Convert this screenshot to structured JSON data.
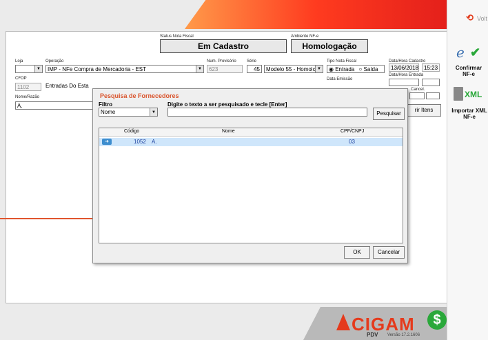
{
  "header": {
    "voltar_label": "Volt"
  },
  "status": {
    "status_label": "Status Nota Fiscal",
    "status_value": "Em Cadastro",
    "ambiente_label": "Ambiente NF-e",
    "ambiente_value": "Homologação"
  },
  "form": {
    "loja_label": "Loja",
    "loja_value": "",
    "operacao_label": "Operação",
    "operacao_value": "IMP - NFe Compra de Mercadoria - EST",
    "num_label": "Num. Provisório",
    "num_value": "623",
    "serie_label": "Série",
    "serie_value": "45",
    "modelo_value": "Modelo 55 - Homolc",
    "tipo_label": "Tipo Nota Fiscal",
    "entrada_label": "Entrada",
    "saida_label": "Saída",
    "dh_cadastro_label": "Data/Hora Cadastro",
    "dh_cadastro_date": "13/06/2018",
    "dh_cadastro_time": "15:23",
    "dh_entrada_label": "Data/Hora Entrada",
    "cfop_label": "CFOP",
    "cfop_code": "1102",
    "cfop_desc": "Entradas Do Esta",
    "data_emissao_label": "Data Emissão",
    "cancel_label": "Cancel.",
    "nome_label": "Nome/Razão",
    "nome_value": "A.",
    "itens_button": "rir Itens"
  },
  "dialog": {
    "title": "Pesquisa de Fornecedores",
    "filtro_label": "Filtro",
    "filtro_value": "Nome",
    "search_label": "Digite o texto a ser pesquisado e tecle [Enter]",
    "search_value": "",
    "search_button": "Pesquisar",
    "columns": {
      "codigo": "Código",
      "nome": "Nome",
      "cpf": "CPF/CNPJ"
    },
    "rows": [
      {
        "codigo": "1052",
        "nome": "A.",
        "cpf": "03"
      }
    ],
    "ok_button": "OK",
    "cancel_button": "Cancelar"
  },
  "sidebar": {
    "confirmar_label": "Confirmar NF-e",
    "importar_label": "Importar XML NF-e",
    "xml_text": "XML"
  },
  "footer": {
    "brand": "CIGAM",
    "sub": "PDV",
    "version": "Versão 17.2.1606"
  },
  "colors": {
    "accent_orange": "#e4201b",
    "highlight_red": "#e0552e",
    "selected_row": "#cfe6fb"
  }
}
